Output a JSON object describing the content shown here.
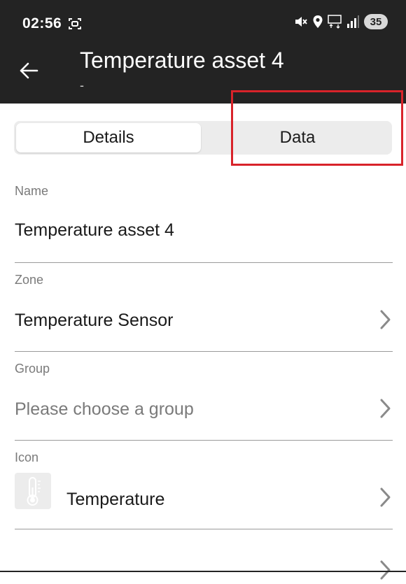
{
  "status_bar": {
    "time": "02:56",
    "battery": "35",
    "icons": [
      "screen-record-icon",
      "mute-icon",
      "location-icon",
      "5g-icon",
      "signal-icon",
      "battery-icon"
    ]
  },
  "app_bar": {
    "title": "Temperature asset 4",
    "subtitle": "-",
    "back_icon": "arrow-left-icon"
  },
  "tabs": [
    {
      "label": "Details",
      "selected": true
    },
    {
      "label": "Data",
      "selected": false
    }
  ],
  "highlight": {
    "target": "Data",
    "color": "#d8232a"
  },
  "form": {
    "name": {
      "label": "Name",
      "value": "Temperature asset 4"
    },
    "zone": {
      "label": "Zone",
      "value": "Temperature Sensor"
    },
    "group": {
      "label": "Group",
      "placeholder": "Please choose a group"
    },
    "icon": {
      "label": "Icon",
      "value": "Temperature",
      "icon": "thermometer-icon"
    }
  },
  "colors": {
    "header_bg": "#232323",
    "tab_bg": "#ececec",
    "label": "#7a7a7a",
    "divider": "#9a9a9a"
  }
}
